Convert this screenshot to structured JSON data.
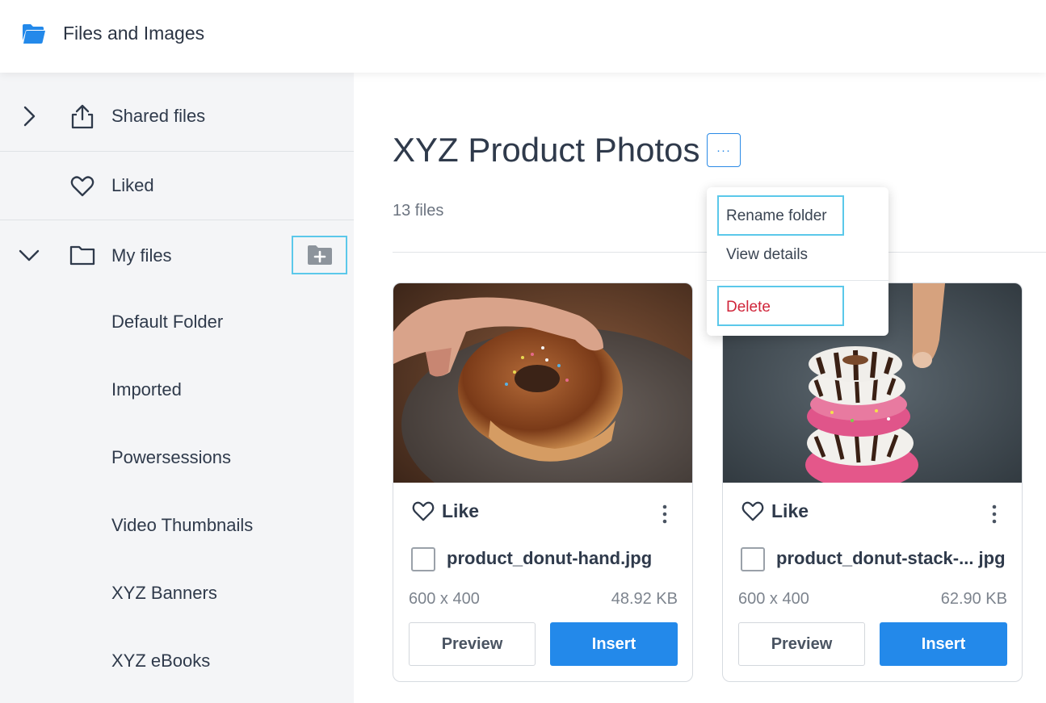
{
  "app": {
    "title": "Files and Images",
    "accent": "#2389ea",
    "highlight": "#5bc8ea"
  },
  "sidebar": {
    "shared": {
      "label": "Shared files",
      "icon": "upload-icon",
      "chevron": "chevron-right-icon"
    },
    "liked": {
      "label": "Liked",
      "icon": "heart-icon"
    },
    "my_files": {
      "label": "My files",
      "icon": "folder-icon",
      "chevron": "chevron-down-icon",
      "action_icon": "new-folder-icon"
    },
    "subfolders": [
      "Default Folder",
      "Imported",
      "Powersessions",
      "Video Thumbnails",
      "XYZ Banners",
      "XYZ eBooks"
    ]
  },
  "main": {
    "folder_title": "XYZ Product Photos",
    "more_label": "···",
    "file_count": "13 files"
  },
  "menu": {
    "rename": "Rename folder",
    "details": "View details",
    "delete": "Delete",
    "delete_color": "#d0253a"
  },
  "cards": [
    {
      "like_label": "Like",
      "filename": "product_donut-hand.jpg",
      "dimensions": "600 x 400",
      "size": "48.92 KB",
      "preview_label": "Preview",
      "insert_label": "Insert"
    },
    {
      "like_label": "Like",
      "filename": "product_donut-stack-... jpg",
      "dimensions": "600 x 400",
      "size": "62.90 KB",
      "preview_label": "Preview",
      "insert_label": "Insert"
    }
  ]
}
